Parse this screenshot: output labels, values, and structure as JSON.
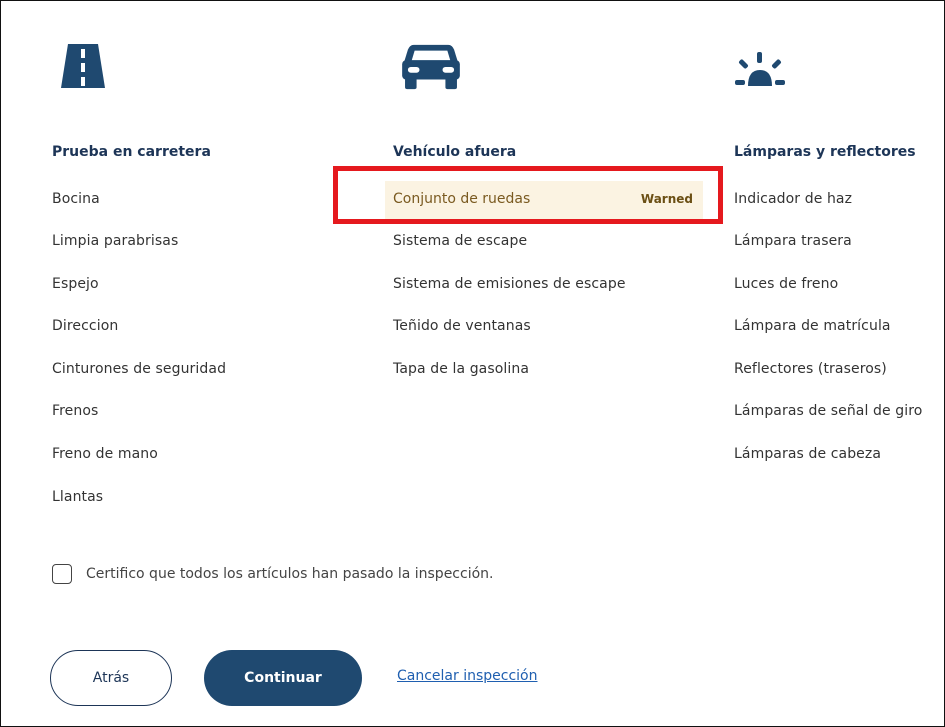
{
  "columns": [
    {
      "icon": "road-icon",
      "title": "Prueba en carretera",
      "items": [
        "Bocina",
        "Limpia parabrisas",
        "Espejo",
        "Direccion",
        "Cinturones de seguridad",
        "Frenos",
        "Freno de mano",
        "Llantas"
      ]
    },
    {
      "icon": "car-front-icon",
      "title": "Vehículo afuera",
      "warned_item": {
        "label": "Conjunto de ruedas",
        "badge": "Warned"
      },
      "items": [
        "Sistema de escape",
        "Sistema de emisiones de escape",
        "Teñido de ventanas",
        "Tapa de la gasolina"
      ]
    },
    {
      "icon": "lamp-icon",
      "title": "Lámparas y reflectores",
      "items": [
        "Indicador de haz",
        "Lámpara trasera",
        "Luces de freno",
        "Lámpara de matrícula",
        "Reflectores (traseros)",
        "Lámparas de señal de giro",
        "Lámparas de cabeza"
      ]
    }
  ],
  "certify": {
    "label": "Certifico que todos los artículos han pasado la inspección.",
    "checked": false
  },
  "actions": {
    "back_label": "Atrás",
    "continue_label": "Continuar",
    "cancel_label": "Cancelar inspección"
  },
  "colors": {
    "brand": "#1f4970",
    "warned_bg": "#fbf3e2",
    "highlight": "#e5191e"
  }
}
